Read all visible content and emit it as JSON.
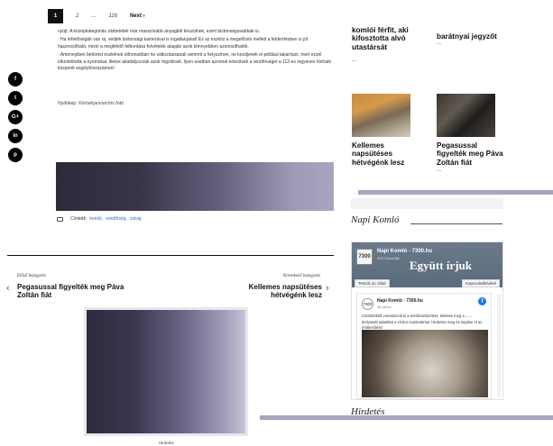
{
  "pagination": {
    "current": "1",
    "pages": [
      "2",
      "...",
      "116"
    ],
    "next": "Next ›"
  },
  "social": [
    "f",
    "t",
    "G+",
    "in",
    "p"
  ],
  "article": {
    "lines": [
      "nyújt. A középkategóriás zárbetétek már masszívabb anyagból készülnek, ezért biztonságosabbak is.",
      "· Ha lehetőségük van rá, védjék biztonsági kamerával is ingatlanjukat! Ez az eszköz a megelőzés mellett a felderítésben is jól hasznosítható, mivel a megfelelő felbontású felvételek alapján azok könnyebben azonosíthatók.",
      "· Amennyiben betörést észlelnek otthonukban ne változtassanak semmit a helyszínen, ne kezdjenek el például takarítani, mert ezzel eltüntethetik a nyomokat, illetve akadályozzák azok rögzítését. Ilyen esetben azonnal értesítsék a rendőrséget a 112-es ingyenes hívható központi segélyhívószámon!"
    ],
    "caption": "Nyitókép: Körtvélyes/archív fotó"
  },
  "tags": {
    "label": "Címkék:",
    "items": [
      "komló,",
      "rendőrség,",
      "zsivaj"
    ]
  },
  "post_nav": {
    "prev_label": "Előző bejegyzés",
    "prev_title": "Pegasussal figyelték meg Páva Zoltán fiát",
    "next_label": "Következő bejegyzés",
    "next_title": "Kellemes napsütéses hétvégénk lesz"
  },
  "bottom_caption": "Hirdetés",
  "sidebar": {
    "top_items": [
      {
        "title": "komlói férfit, aki kifosztotta alvó utastársát",
        "more": "..."
      },
      {
        "title": "barátnyai jegyzőt",
        "more": "..."
      }
    ],
    "mid_items": [
      {
        "title": "Kellemes napsütéses hétvégénk lesz",
        "more": "..."
      },
      {
        "title": "Pegasussal figyelték meg Páva Zoltán fiát",
        "more": "..."
      }
    ],
    "napi_heading": "Napi Komló",
    "hirdetes_heading": "Hirdetés"
  },
  "facebook": {
    "page_name": "Napi Komló - 7300.hu",
    "followers": "2013 követője",
    "slogan": "Együtt írjuk",
    "like_button": "Tetszik az oldal",
    "contact_button": "Kapcsolatfelvétel",
    "logo": "7300",
    "post_name": "Napi Komló - 7300.hu",
    "post_time": "45 perce",
    "post_text": "Csütörtöktől vonatozunk ki a mérőeszközöket, tekintse meg a ....... leolvasott adatokat a vízóra munkatársai. Hirdesse meg és segítse el az értékesítést!"
  },
  "colors": {
    "accent_bar": "#a8a4c0",
    "link": "#2f6db5",
    "fb_blue": "#1877f2"
  }
}
